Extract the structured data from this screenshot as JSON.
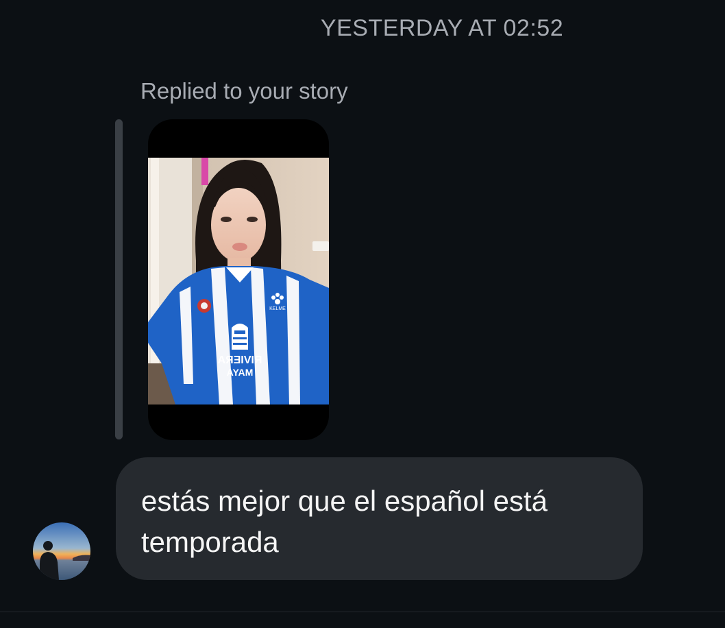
{
  "thread": {
    "timestamp": "YESTERDAY AT 02:52",
    "reply_label": "Replied to your story"
  },
  "message": {
    "text": "estás mejor que el español está temporada"
  },
  "story": {
    "shirt_text_line1": "RIVIERA",
    "shirt_text_line2": "MAYA",
    "shirt_brand": "KELME"
  },
  "colors": {
    "background": "#0c1014",
    "bubble": "#262a2f",
    "secondary_text": "#a8acb3",
    "reply_bar": "#3a3f45"
  }
}
